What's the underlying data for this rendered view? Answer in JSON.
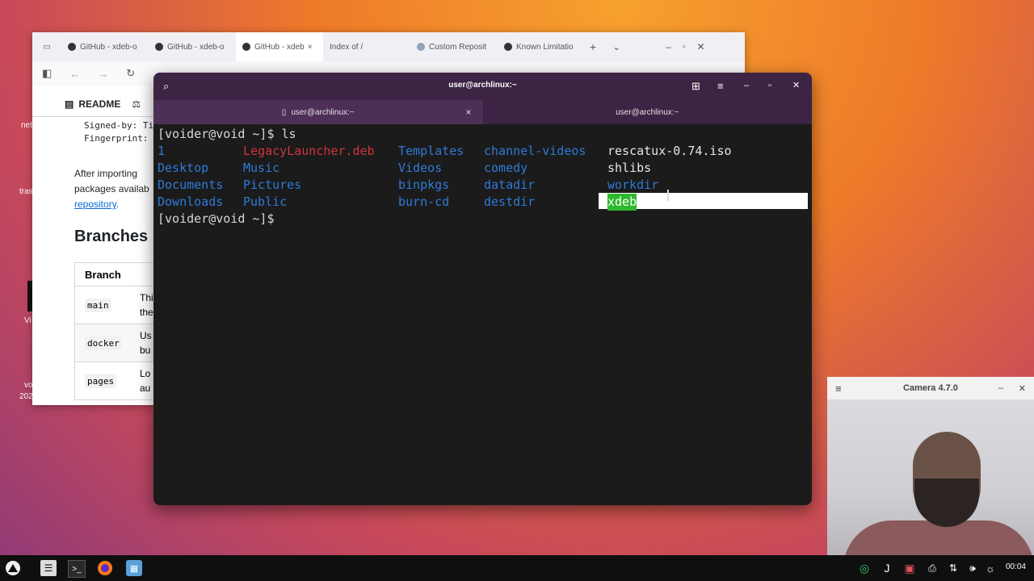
{
  "desktop": {
    "frag1": "net",
    "frag2": "tras",
    "frag3": "Vi",
    "frag4": "vo",
    "frag5": "202"
  },
  "browser": {
    "tabs": [
      {
        "label": "GitHub - xdeb-o"
      },
      {
        "label": "GitHub - xdeb-o"
      },
      {
        "label": "GitHub - xdeb"
      },
      {
        "label": "Index of /"
      },
      {
        "label": "Custom Reposit"
      },
      {
        "label": "Known Limitatio"
      }
    ],
    "new_tab": "+",
    "tabs_menu": "⌄",
    "readme_label": "README",
    "signed_by": "Signed-by: Ti",
    "fingerprint": "Fingerprint:",
    "after_importing": "After importing",
    "packages_available": "packages availab",
    "repository_link": "repository",
    "branches_title": "Branches",
    "branch_header": "Branch",
    "branches": [
      {
        "name": "main",
        "desc1": "Thi",
        "desc2": "the"
      },
      {
        "name": "docker",
        "desc1": "Us",
        "desc2": "bu"
      },
      {
        "name": "pages",
        "desc1": "Lo",
        "desc2": "au"
      }
    ]
  },
  "terminal": {
    "title": "user@archlinux:~",
    "tabs": [
      {
        "label": "user@archlinux:~"
      },
      {
        "label": "user@archlinux:~"
      }
    ],
    "prompt1": "[voider@void ~]$ ls",
    "prompt2": "[voider@void ~]$",
    "ls": {
      "c1": [
        "1",
        "Desktop",
        "Documents",
        "Downloads"
      ],
      "c2": [
        "LegacyLauncher.deb",
        "Music",
        "Pictures",
        "Public"
      ],
      "c3": [
        "Templates",
        "Videos",
        "binpkgs",
        "burn-cd"
      ],
      "c4": [
        "channel-videos",
        "comedy",
        "datadir",
        "destdir"
      ],
      "c5": [
        "rescatux-0.74.iso",
        "shlibs",
        "workdir",
        "xdeb"
      ]
    }
  },
  "camera": {
    "title": "Camera 4.7.0"
  },
  "taskbar": {
    "clock": "00:04"
  }
}
